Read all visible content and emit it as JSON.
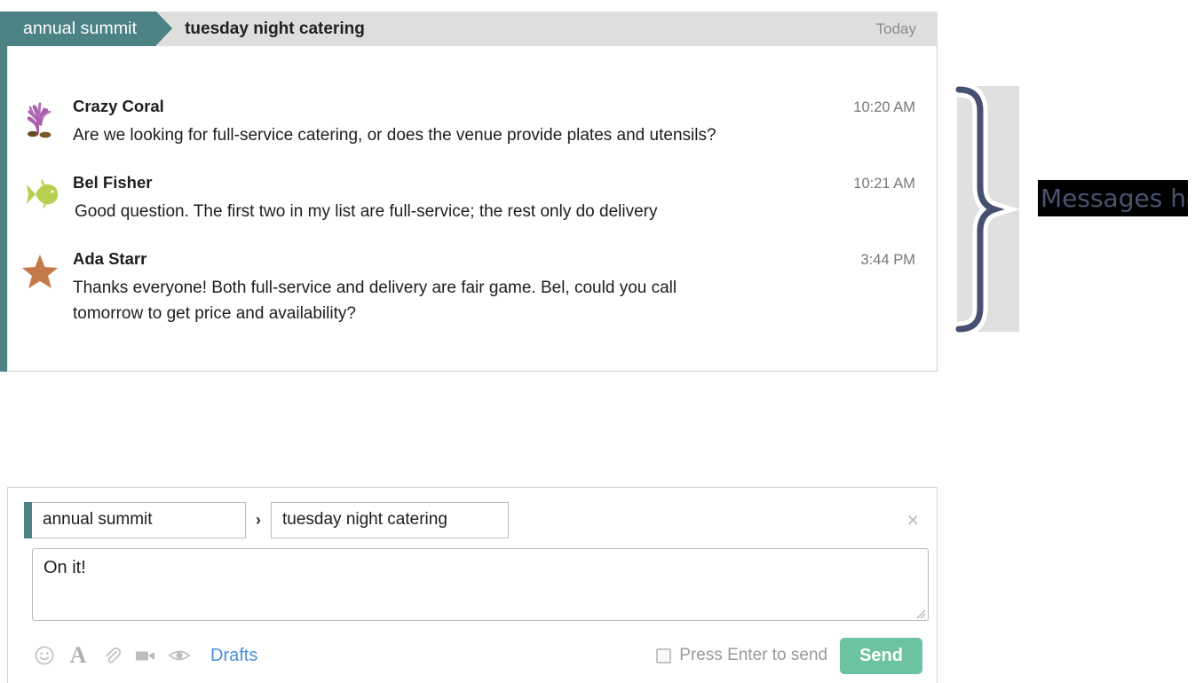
{
  "conversation": {
    "room_tab_label": "annual summit",
    "topic_title": "tuesday night catering",
    "date_label": "Today",
    "messages": [
      {
        "author": "Crazy Coral",
        "time": "10:20 AM",
        "text": "Are we looking for full-service catering, or does the venue provide plates and utensils?",
        "avatar": "coral-avatar"
      },
      {
        "author": "Bel Fisher",
        "time": "10:21 AM",
        "text": "Good question. The first two in my list are full-service; the rest only do delivery",
        "avatar": "fish-avatar"
      },
      {
        "author": "Ada Starr",
        "time": "3:44 PM",
        "text": "Thanks everyone! Both full-service and delivery are fair game. Bel, could you call tomorrow to get price and availability?",
        "avatar": "starfish-avatar"
      }
    ]
  },
  "annotation": {
    "icon": "curly-brace-icon",
    "label": "Messages hours apart"
  },
  "compose": {
    "room_value": "annual summit",
    "separator": "›",
    "topic_value": "tuesday night catering",
    "close_glyph": "×",
    "body_value": "On it!",
    "toolbar": {
      "emoji_glyph": "☺",
      "format_glyph": "A",
      "attach_glyph": "📎",
      "video_glyph": "■",
      "preview_glyph": "◉",
      "drafts_label": "Drafts"
    },
    "enter_to_send_label": "Press Enter to send",
    "enter_to_send_checked": false,
    "send_label": "Send"
  },
  "colors": {
    "accent_teal": "#4c8284",
    "send_green": "#6dc2a0",
    "header_gray": "#dededd",
    "annotation_navy": "#4a5470",
    "drafts_blue": "#4a90d9"
  }
}
